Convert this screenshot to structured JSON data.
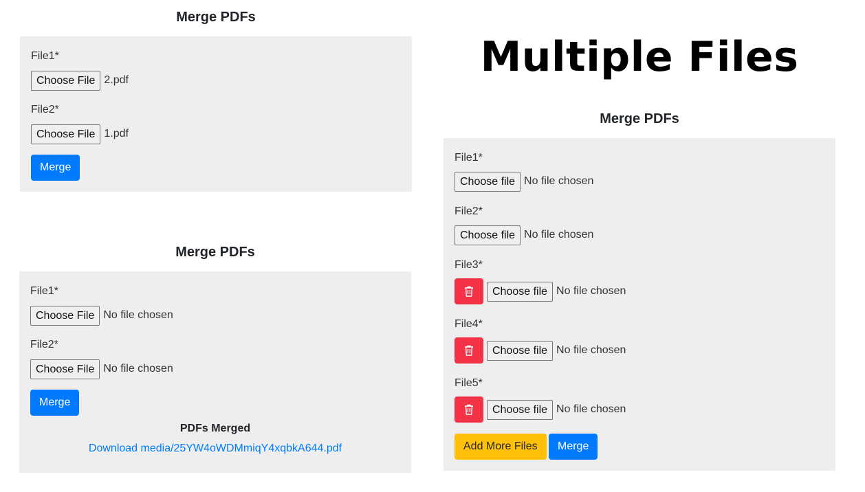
{
  "title": "Multiple Files",
  "form1": {
    "heading": "Merge PDFs",
    "fields": [
      {
        "label": "File1*",
        "button": "Choose File",
        "status": "2.pdf"
      },
      {
        "label": "File2*",
        "button": "Choose File",
        "status": "1.pdf"
      }
    ],
    "merge_label": "Merge"
  },
  "form2": {
    "heading": "Merge PDFs",
    "fields": [
      {
        "label": "File1*",
        "button": "Choose File",
        "status": "No file chosen"
      },
      {
        "label": "File2*",
        "button": "Choose File",
        "status": "No file chosen"
      }
    ],
    "merge_label": "Merge",
    "result_title": "PDFs Merged",
    "download_link": "Download media/25YW4oWDMmiqY4xqbkA644.pdf"
  },
  "form3": {
    "heading": "Merge PDFs",
    "fields": [
      {
        "label": "File1*",
        "button": "Choose file",
        "status": "No file chosen"
      },
      {
        "label": "File2*",
        "button": "Choose file",
        "status": "No file chosen"
      },
      {
        "label": "File3*",
        "button": "Choose file",
        "status": "No file chosen",
        "deletable": true
      },
      {
        "label": "File4*",
        "button": "Choose file",
        "status": "No file chosen",
        "deletable": true
      },
      {
        "label": "File5*",
        "button": "Choose file",
        "status": "No file chosen",
        "deletable": true
      }
    ],
    "add_more_label": "Add More Files",
    "merge_label": "Merge"
  },
  "colors": {
    "primary": "#007bff",
    "danger": "#f53347",
    "warning": "#ffc107",
    "panel": "#eeeeee"
  },
  "icons": {
    "delete": "trash-icon"
  }
}
